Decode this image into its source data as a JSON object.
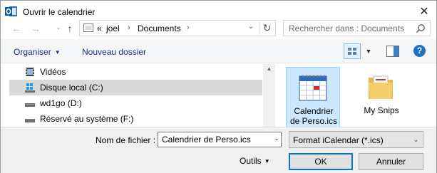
{
  "window": {
    "title": "Ouvrir le calendrier",
    "app_icon": "outlook-icon",
    "close_glyph": "✕"
  },
  "nav": {
    "back_glyph": "←",
    "forward_glyph": "→",
    "up_glyph": "↑",
    "recent_glyph": "⌄",
    "breadcrumb_prefix": "«",
    "breadcrumbs": [
      "joel",
      "Documents"
    ],
    "crumb_separator": "›",
    "address_dropdown_glyph": "⌄",
    "refresh_glyph": "↻",
    "search_placeholder": "Rechercher dans : Documents"
  },
  "toolbar": {
    "organize_label": "Organiser",
    "organize_caret": "▼",
    "new_folder_label": "Nouveau dossier",
    "view_dropdown_glyph": "▼",
    "help_label": "?"
  },
  "tree": {
    "items": [
      {
        "label": "Vidéos",
        "icon": "video-folder-icon"
      },
      {
        "label": "Disque local (C:)",
        "icon": "windows-drive-icon",
        "selected": true
      },
      {
        "label": "wd1go (D:)",
        "icon": "drive-icon"
      },
      {
        "label": "Réservé au système (F:)",
        "icon": "drive-icon"
      }
    ],
    "scroll_up_glyph": "▲"
  },
  "files": [
    {
      "label_line1": "Calendrier",
      "label_line2": "de Perso.ics",
      "icon": "calendar-file-icon",
      "selected": true
    },
    {
      "label_line1": "My Snips",
      "label_line2": "",
      "icon": "folder-icon",
      "selected": false
    }
  ],
  "bottom": {
    "filename_label": "Nom de fichier :",
    "filename_value": "Calendrier de Perso.ics",
    "filename_dropdown_glyph": "⌄",
    "filter_value": "Format iCalendar (*.ics)",
    "filter_dropdown_glyph": "⌄",
    "tools_label": "Outils",
    "tools_caret": "▼",
    "ok_label": "OK",
    "cancel_label": "Annuler"
  },
  "colors": {
    "accent": "#0078d7",
    "toolbar_link": "#1e3287",
    "selection": "#cce8ff",
    "tree_selection": "#d9d9d9",
    "help": "#1f6fc5"
  }
}
